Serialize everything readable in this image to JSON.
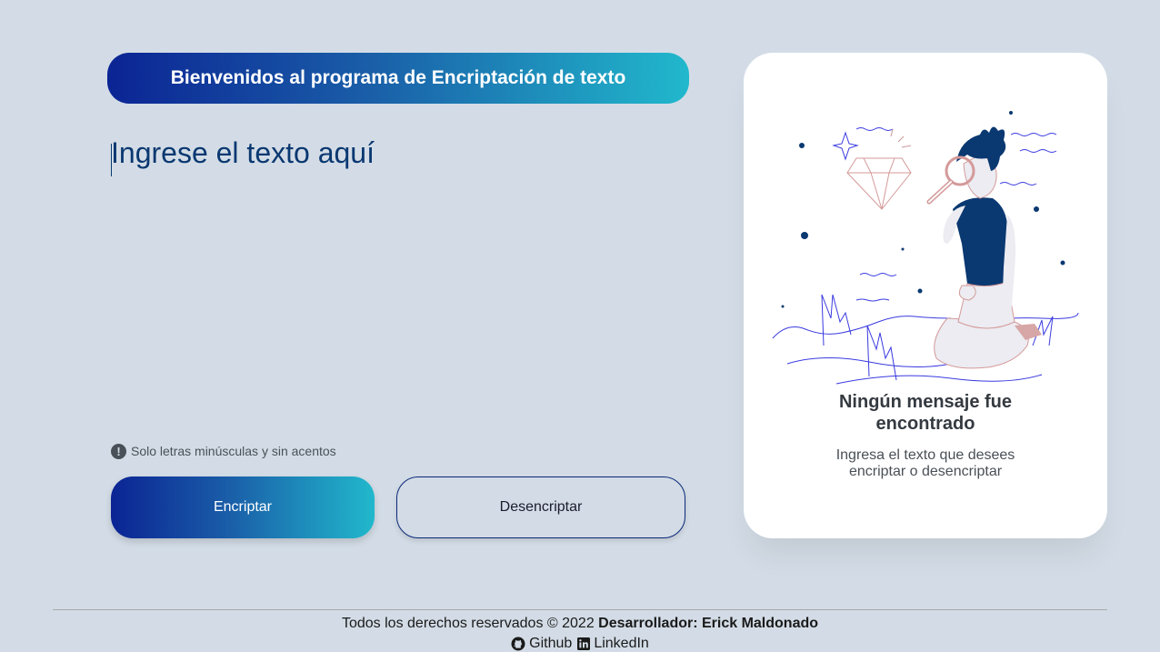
{
  "header": {
    "title": "Bienvenidos al programa de Encriptación de texto"
  },
  "input": {
    "placeholder": "Ingrese el texto aquí",
    "value": ""
  },
  "hint": {
    "icon": "exclamation-circle-icon",
    "text": "Solo letras minúsculas y sin acentos"
  },
  "buttons": {
    "encrypt_label": "Encriptar",
    "decrypt_label": "Desencriptar"
  },
  "output": {
    "illustration": "person-with-magnifying-glass-illustration",
    "title": "Ningún mensaje fue encontrado",
    "text": "Ingresa el texto que desees encriptar o desencriptar"
  },
  "footer": {
    "rights_text": "Todos los derechos reservados © 2022",
    "developer_text": "Desarrollador: Erick Maldonado",
    "links": [
      {
        "label": "Github",
        "icon": "github-icon"
      },
      {
        "label": "LinkedIn",
        "icon": "linkedin-icon"
      }
    ]
  },
  "colors": {
    "background": "#d3dce6",
    "accent_dark": "#0b2494",
    "accent_light": "#21b8cc",
    "text_primary": "#0a3871",
    "card": "#ffffff"
  }
}
